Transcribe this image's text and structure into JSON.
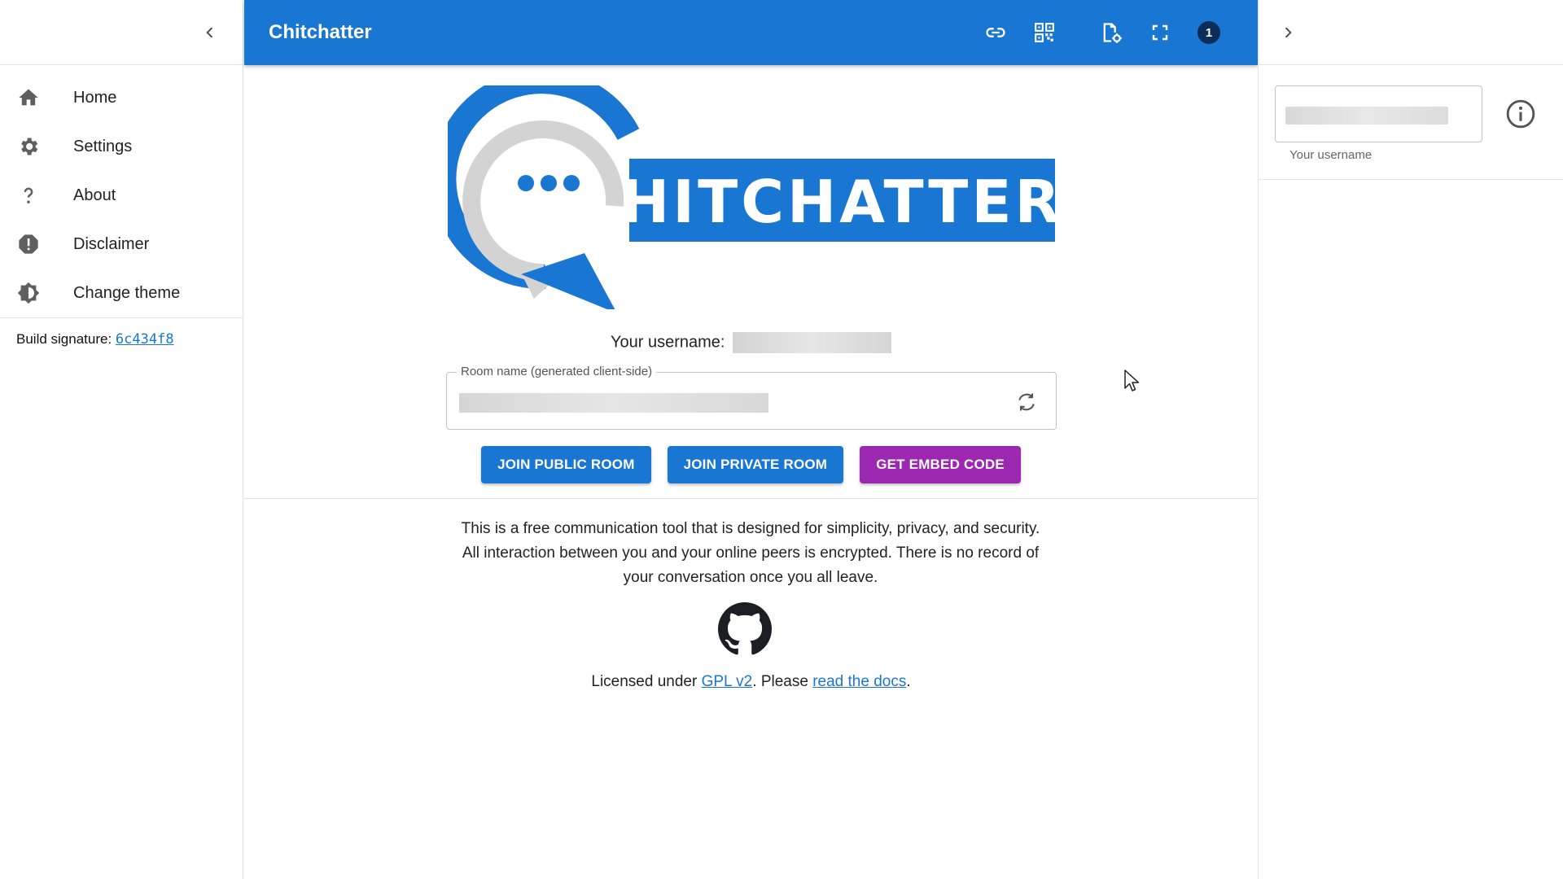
{
  "nav": {
    "items": [
      {
        "label": "Home",
        "icon": "home-icon"
      },
      {
        "label": "Settings",
        "icon": "gear-icon"
      },
      {
        "label": "About",
        "icon": "question-icon"
      },
      {
        "label": "Disclaimer",
        "icon": "alert-icon"
      },
      {
        "label": "Change theme",
        "icon": "theme-icon"
      }
    ],
    "build_label": "Build signature:",
    "build_hash": "6c434f8"
  },
  "app_bar": {
    "title": "Chitchatter",
    "peer_count": "1",
    "icons": [
      "link-icon",
      "qr-code-icon",
      "room-settings-icon",
      "fullscreen-icon"
    ]
  },
  "logo": {
    "wordmark": "HITCHATTER"
  },
  "main": {
    "username_label": "Your username:",
    "room_field_label": "Room name (generated client-side)",
    "buttons": {
      "join_public": "JOIN PUBLIC ROOM",
      "join_private": "JOIN PRIVATE ROOM",
      "embed": "GET EMBED CODE"
    },
    "description": "This is a free communication tool that is designed for simplicity, privacy, and security. All interaction between you and your online peers is encrypted. There is no record of your conversation once you all leave.",
    "license_prefix": "Licensed under ",
    "license_link": "GPL v2",
    "license_middle": ". Please ",
    "docs_link": "read the docs",
    "license_suffix": "."
  },
  "right_panel": {
    "username_helper": "Your username"
  },
  "colors": {
    "primary": "#1976d2",
    "embed_button": "#9c27b0",
    "badge": "#0b2d57",
    "logo_gray": "#d3d3d3"
  }
}
